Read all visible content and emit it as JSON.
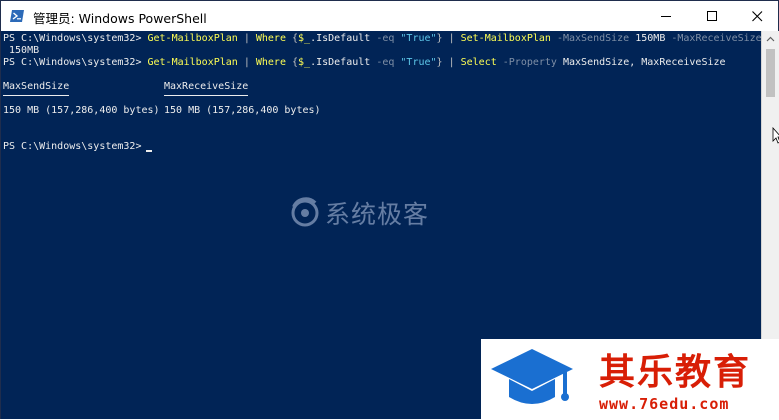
{
  "window": {
    "title": "管理员: Windows PowerShell",
    "title_icon": "powershell-icon",
    "controls": [
      "minimize-icon",
      "maximize-icon",
      "close-icon"
    ]
  },
  "console": {
    "line1": {
      "prompt": "PS C:\\Windows\\system32> ",
      "cmd1": "Get-MailboxPlan",
      "pipe1": " | ",
      "where": "Where",
      "brace_open": " {",
      "var": "$_",
      "prop": ".IsDefault",
      "eq": " -eq ",
      "str": "\"True\"",
      "brace_close": "}",
      "pipe2": " | ",
      "cmd2": "Set-MailboxPlan",
      "param1": " -MaxSendSize ",
      "val1": "150MB",
      "param2": " -MaxReceiveSize"
    },
    "line1_wrap": " 150MB",
    "line2": {
      "prompt": "PS C:\\Windows\\system32> ",
      "cmd1": "Get-MailboxPlan",
      "pipe1": " | ",
      "where": "Where",
      "brace_open": " {",
      "var": "$_",
      "prop": ".IsDefault",
      "eq": " -eq ",
      "str": "\"True\"",
      "brace_close": "}",
      "pipe2": " | ",
      "select": "Select",
      "param": " -Property ",
      "props": "MaxSendSize, MaxReceiveSize"
    },
    "table": {
      "headers": [
        "MaxSendSize",
        "MaxReceiveSize"
      ],
      "rows": [
        [
          "150 MB (157,286,400 bytes)",
          "150 MB (157,286,400 bytes)"
        ]
      ]
    },
    "prompt_final": "PS C:\\Windows\\system32> "
  },
  "watermark": {
    "text": "系统极客",
    "icon": "systemgeek-logo-icon"
  },
  "promo": {
    "title": "其乐教育",
    "url": "www.76edu.com",
    "icon": "graduation-cap-icon"
  },
  "colors": {
    "console_bg": "#012456",
    "command": "#fefe54",
    "text": "#ededed",
    "string": "#5dc6e8",
    "promo_red": "#d81e06",
    "promo_blue": "#1a6fd1"
  }
}
